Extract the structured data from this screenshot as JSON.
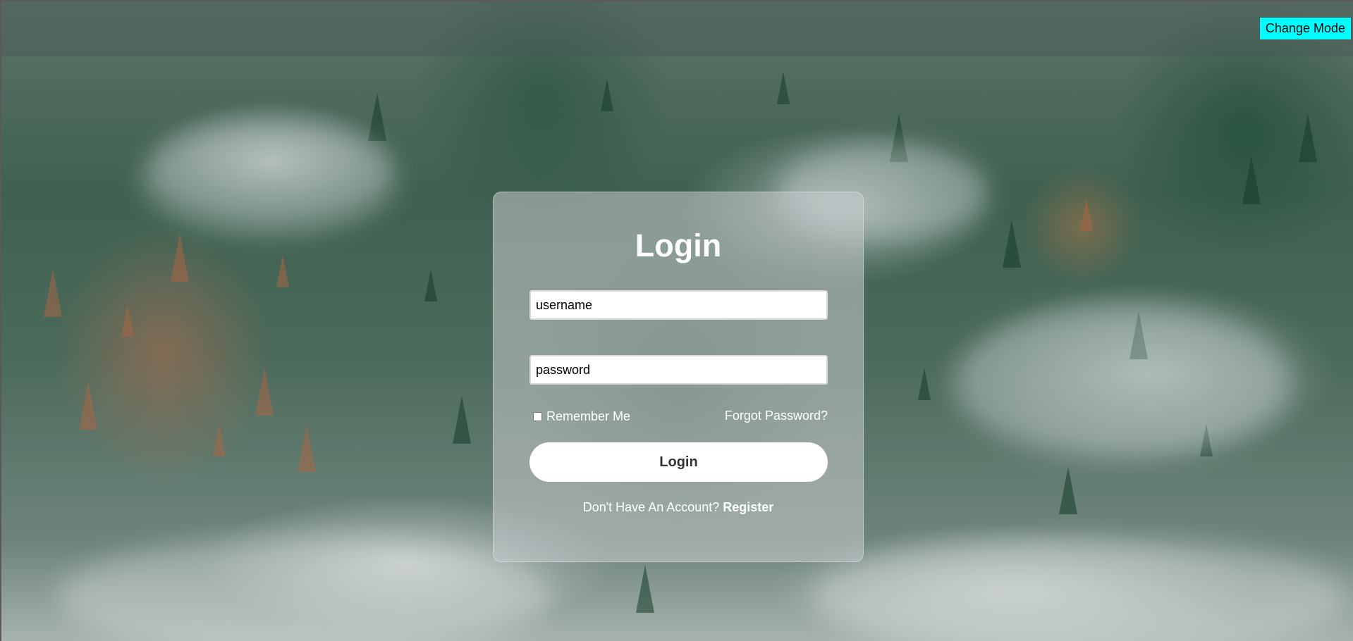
{
  "header": {
    "change_mode_label": "Change Mode"
  },
  "login_card": {
    "title": "Login",
    "username": {
      "placeholder": "username",
      "value": ""
    },
    "password": {
      "placeholder": "password",
      "value": ""
    },
    "remember_me_label": "Remember Me",
    "remember_me_checked": false,
    "forgot_password_label": "Forgot Password?",
    "submit_label": "Login",
    "no_account_text": "Don't Have An Account?",
    "register_label": "Register"
  },
  "colors": {
    "mode_button_bg": "#00ffff",
    "card_bg": "rgba(200,202,207,0.55)",
    "text": "#ffffff"
  }
}
